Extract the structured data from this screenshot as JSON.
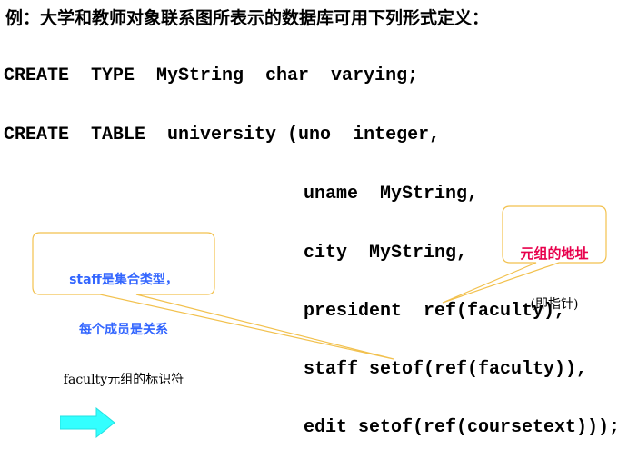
{
  "heading": "例：大学和教师对象联系图所表示的数据库可用下列形式定义：",
  "code_lines": [
    "CREATE  TYPE  MyString  char  varying;",
    "CREATE  TABLE  university (uno  integer,",
    "uname  MyString,",
    "city  MyString,",
    "president  ref(faculty),",
    "staff setof(ref(faculty)),",
    "edit setof(ref(coursetext)));"
  ],
  "callout_left": {
    "lines": [
      "staff是集合类型，",
      "每个成员是关系",
      "faculty元组的标识符"
    ],
    "border_color": "#f2c14e"
  },
  "callout_right": {
    "lines": [
      "元组的地址",
      "(即指针)"
    ],
    "border_color": "#f2c14e"
  },
  "arrow": {
    "icon": "right-arrow-icon",
    "color": "#33ffff"
  }
}
